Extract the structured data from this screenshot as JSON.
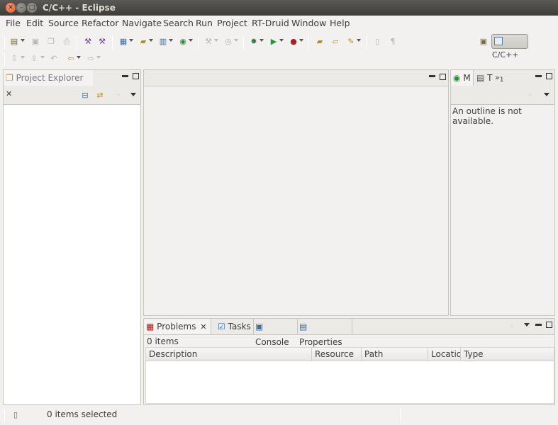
{
  "window": {
    "title": "C/C++ - Eclipse"
  },
  "menu": [
    "File",
    "Edit",
    "Source",
    "Refactor",
    "Navigate",
    "Search",
    "Run",
    "Project",
    "RT-Druid",
    "Window",
    "Help"
  ],
  "perspective": {
    "active_label": "C/C++"
  },
  "project_explorer": {
    "tab_label": "Project Explorer"
  },
  "outline": {
    "tab1": "M",
    "tab2": "T",
    "overflow": "»",
    "overflow_count": "1",
    "message": "An outline is not available."
  },
  "bottom_panel": {
    "tabs": [
      "Problems",
      "Tasks",
      "Console",
      "Properties"
    ],
    "items_count": "0 items",
    "columns": [
      "Description",
      "Resource",
      "Path",
      "Locatio",
      "Type"
    ]
  },
  "status": {
    "text": "0 items selected"
  },
  "icons": {
    "close": "close-icon",
    "accent": "#e1541f"
  }
}
